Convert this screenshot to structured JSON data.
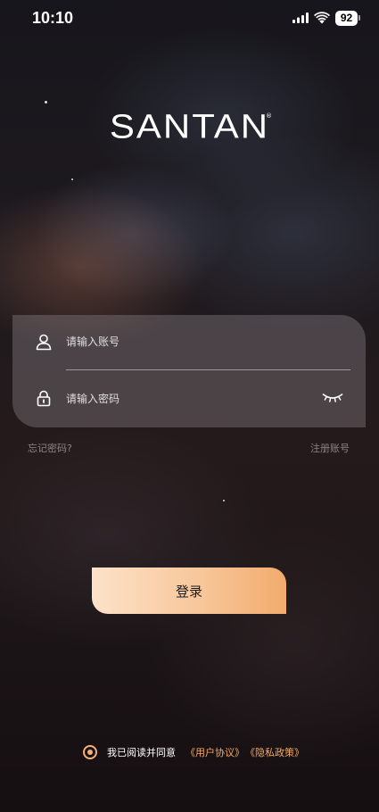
{
  "status_bar": {
    "time": "10:10",
    "battery": "92",
    "icons": [
      "signal-icon",
      "wifi-icon",
      "battery-icon"
    ]
  },
  "logo": {
    "text": "SANTAN",
    "registered_mark": "®"
  },
  "login_form": {
    "account_placeholder": "请输入账号",
    "password_placeholder": "请输入密码",
    "account_icon": "user-icon",
    "password_icon": "lock-icon",
    "visibility_icon": "eye-closed-icon"
  },
  "links": {
    "forgot_password": "忘记密码?",
    "register": "注册账号"
  },
  "login_button": {
    "label": "登录"
  },
  "agreement": {
    "prefix": "我已阅读并同意",
    "user_agreement": "《用户协议》",
    "privacy_policy": "《隐私政策》"
  },
  "colors": {
    "accent": "#f3a862",
    "button_gradient_start": "#fde2c9",
    "button_gradient_end": "#f2ab6d"
  }
}
